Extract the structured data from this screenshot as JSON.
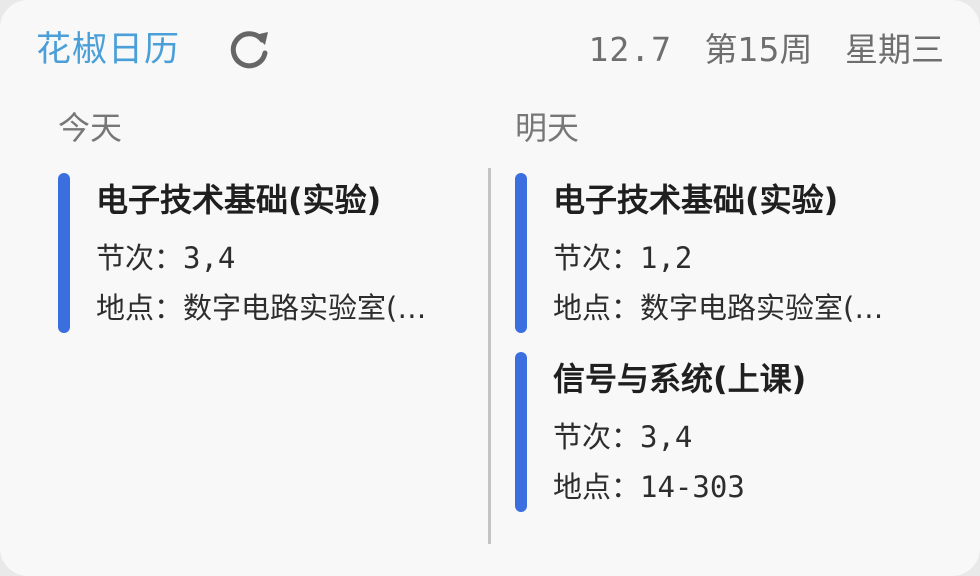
{
  "header": {
    "app_title": "花椒日历",
    "date": "12.7",
    "week": "第15周",
    "weekday": "星期三",
    "refresh_icon": "refresh-icon",
    "accent_color": "#4a9fd8"
  },
  "today": {
    "label": "今天",
    "courses": [
      {
        "name": "电子技术基础(实验)",
        "session_label": "节次：",
        "session": "3,4",
        "location_label": "地点：",
        "location": "数字电路实验室(…"
      }
    ]
  },
  "tomorrow": {
    "label": "明天",
    "courses": [
      {
        "name": "电子技术基础(实验)",
        "session_label": "节次：",
        "session": "1,2",
        "location_label": "地点：",
        "location": "数字电路实验室(…"
      },
      {
        "name": "信号与系统(上课)",
        "session_label": "节次：",
        "session": "3,4",
        "location_label": "地点：",
        "location": "14-303"
      }
    ]
  },
  "colors": {
    "card_bar": "#3b6fe0",
    "background": "#f8f8f8"
  }
}
